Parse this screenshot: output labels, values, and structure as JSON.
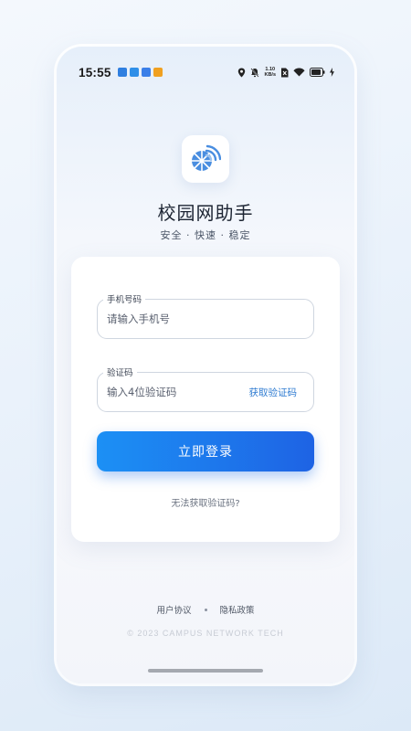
{
  "status_bar": {
    "time": "15:55",
    "net_speed_value": "1.10",
    "net_speed_unit": "KB/s",
    "notification_colors": [
      "#2f7fe0",
      "#2f8fe8",
      "#3a7fe8",
      "#f0a020"
    ]
  },
  "app": {
    "title": "校园网助手",
    "tagline": "安全 · 快速 · 稳定"
  },
  "form": {
    "phone_label": "手机号码",
    "phone_placeholder": "请输入手机号",
    "code_label": "验证码",
    "code_placeholder": "输入4位验证码",
    "get_code_label": "获取验证码",
    "login_label": "立即登录",
    "help_label": "无法获取验证码?"
  },
  "footer": {
    "user_agreement": "用户协议",
    "privacy_policy": "隐私政策",
    "copyright": "© 2023 CAMPUS NETWORK TECH"
  },
  "colors": {
    "accent": "#1e7be8",
    "link": "#2e7bd1",
    "logo_primary": "#4a8ee0",
    "logo_secondary": "#9cc3f0"
  }
}
